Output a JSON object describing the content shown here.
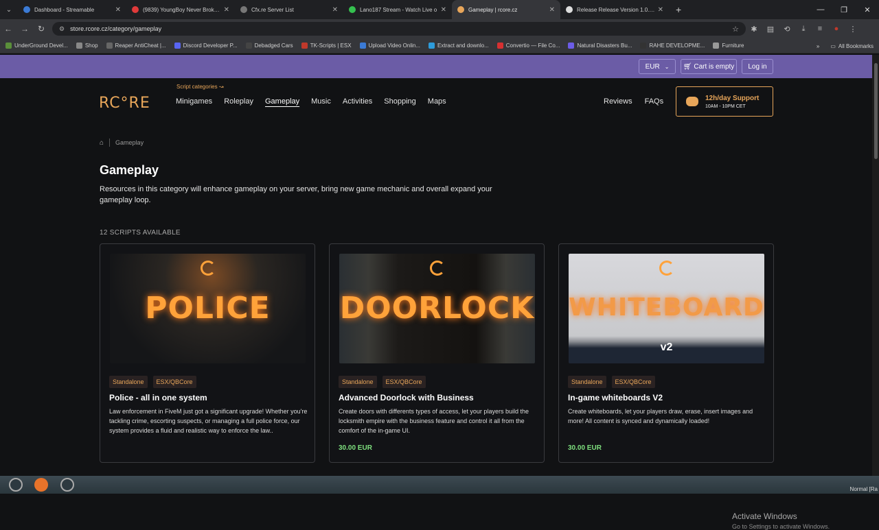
{
  "browser": {
    "tabs": [
      {
        "title": "Dashboard - Streamable",
        "color": "#3b7bd6"
      },
      {
        "title": "(9839) YoungBoy Never Broke A",
        "color": "#e03a3a"
      },
      {
        "title": "Cfx.re Server List",
        "color": "#777"
      },
      {
        "title": "Lano187 Stream - Watch Live o",
        "color": "#35c04f"
      },
      {
        "title": "Gameplay | rcore.cz",
        "color": "#e8a65a"
      },
      {
        "title": "Release Release Version 1.0.0 · A",
        "color": "#ddd"
      }
    ],
    "url": "store.rcore.cz/category/gameplay",
    "bookmarks": [
      {
        "label": "UnderGround Devel...",
        "color": "#5a8f3a"
      },
      {
        "label": "Shop",
        "color": "#888"
      },
      {
        "label": "Reaper AntiCheat |...",
        "color": "#666"
      },
      {
        "label": "Discord Developer P...",
        "color": "#5865f2"
      },
      {
        "label": "Debadged Cars",
        "color": "#444"
      },
      {
        "label": "TK-Scripts | ESX",
        "color": "#c0392b"
      },
      {
        "label": "Upload Video Onlin...",
        "color": "#3b7bd6"
      },
      {
        "label": "Extract and downlo...",
        "color": "#2d9cdb"
      },
      {
        "label": "Convertio — File Co...",
        "color": "#d63031"
      },
      {
        "label": "Natural Disasters Bu...",
        "color": "#6c5ce7"
      },
      {
        "label": "RAHE DEVELOPME...",
        "color": "#333"
      },
      {
        "label": "Furniture",
        "color": "#999"
      }
    ],
    "all_bookmarks": "All Bookmarks"
  },
  "topbar": {
    "currency": "EUR",
    "cart": "Cart is empty",
    "login": "Log in"
  },
  "header": {
    "logo": "RC°RE",
    "categories_label": "Script categories",
    "menu": [
      "Minigames",
      "Roleplay",
      "Gameplay",
      "Music",
      "Activities",
      "Shopping",
      "Maps"
    ],
    "right_links": [
      "Reviews",
      "FAQs"
    ],
    "support_title": "12h/day Support",
    "support_hours": "10AM - 10PM CET"
  },
  "breadcrumb": "Gameplay",
  "page": {
    "title": "Gameplay",
    "description": "Resources in this category will enhance gameplay on your server, bring new game mechanic and overall expand your gameplay loop.",
    "count": "12 SCRIPTS AVAILABLE"
  },
  "cards": [
    {
      "image_word": "POLICE",
      "tags": [
        "Standalone",
        "ESX/QBCore"
      ],
      "title": "Police - all in one system",
      "description": "Law enforcement in FiveM just got a significant upgrade! Whether you're tackling crime, escorting suspects, or managing a full police force, our system provides a fluid and realistic way to enforce the law..",
      "price": ""
    },
    {
      "image_word": "DOORLOCK",
      "tags": [
        "Standalone",
        "ESX/QBCore"
      ],
      "title": "Advanced Doorlock with Business",
      "description": "Create doors with differents types of access, let your players build the locksmith empire with the business feature and control it all from the comfort of the in-game UI.",
      "price": "30.00 EUR"
    },
    {
      "image_word": "WHITEBOARDS",
      "image_sub": "v2",
      "tags": [
        "Standalone",
        "ESX/QBCore"
      ],
      "title": "In-game whiteboards V2",
      "description": "Create whiteboards, let your players draw, erase, insert images and more! All content is synced and dynamically loaded!",
      "price": "30.00 EUR"
    }
  ],
  "overlay": {
    "activate_title": "Activate Windows",
    "activate_sub": "Go to Settings to activate Windows.",
    "normal": "Normal [Ra"
  }
}
